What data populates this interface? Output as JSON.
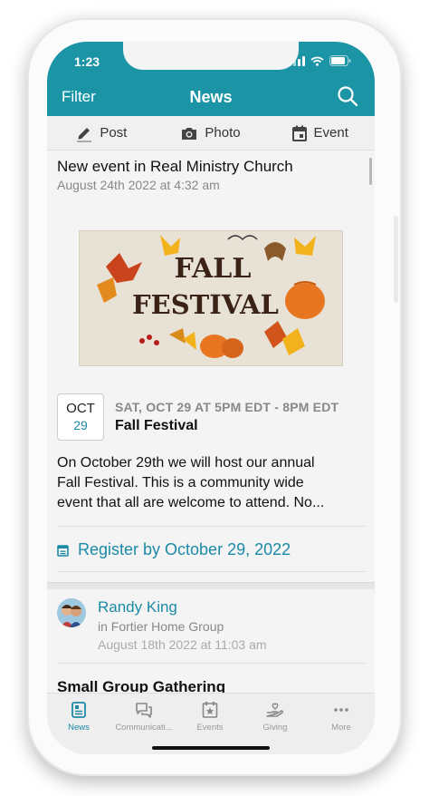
{
  "status_bar": {
    "time": "1:23"
  },
  "nav": {
    "filter": "Filter",
    "title": "News"
  },
  "actions": [
    {
      "label": "Post",
      "icon": "pencil-icon"
    },
    {
      "label": "Photo",
      "icon": "camera-icon"
    },
    {
      "label": "Event",
      "icon": "calendar-icon"
    }
  ],
  "post": {
    "title": "New event in Real Ministry Church",
    "date": "August 24th 2022 at 4:32 am",
    "banner_text": [
      "FALL",
      "FESTIVAL"
    ],
    "event": {
      "month": "OCT",
      "day": "29",
      "time": "SAT, OCT 29 AT 5PM EDT - 8PM EDT",
      "name": "Fall Festival",
      "description": [
        "On October 29th we will host our annual",
        "Fall Festival. This is a community wide",
        "event that all are welcome to attend. No..."
      ]
    },
    "register": "Register by October 29, 2022"
  },
  "next_post": {
    "author": "Randy King",
    "group": "in Fortier Home Group",
    "date": "August 18th 2022 at 11:03 am",
    "title": "Small Group Gathering"
  },
  "tabs": [
    {
      "label": "News",
      "icon": "news-icon",
      "active": true
    },
    {
      "label": "Communicati...",
      "icon": "chat-icon",
      "active": false
    },
    {
      "label": "Events",
      "icon": "events-icon",
      "active": false
    },
    {
      "label": "Giving",
      "icon": "giving-icon",
      "active": false
    },
    {
      "label": "More",
      "icon": "more-icon",
      "active": false
    }
  ],
  "colors": {
    "brand": "#1b95a5",
    "link": "#1b8aa6",
    "background": "#f4f4f4"
  }
}
